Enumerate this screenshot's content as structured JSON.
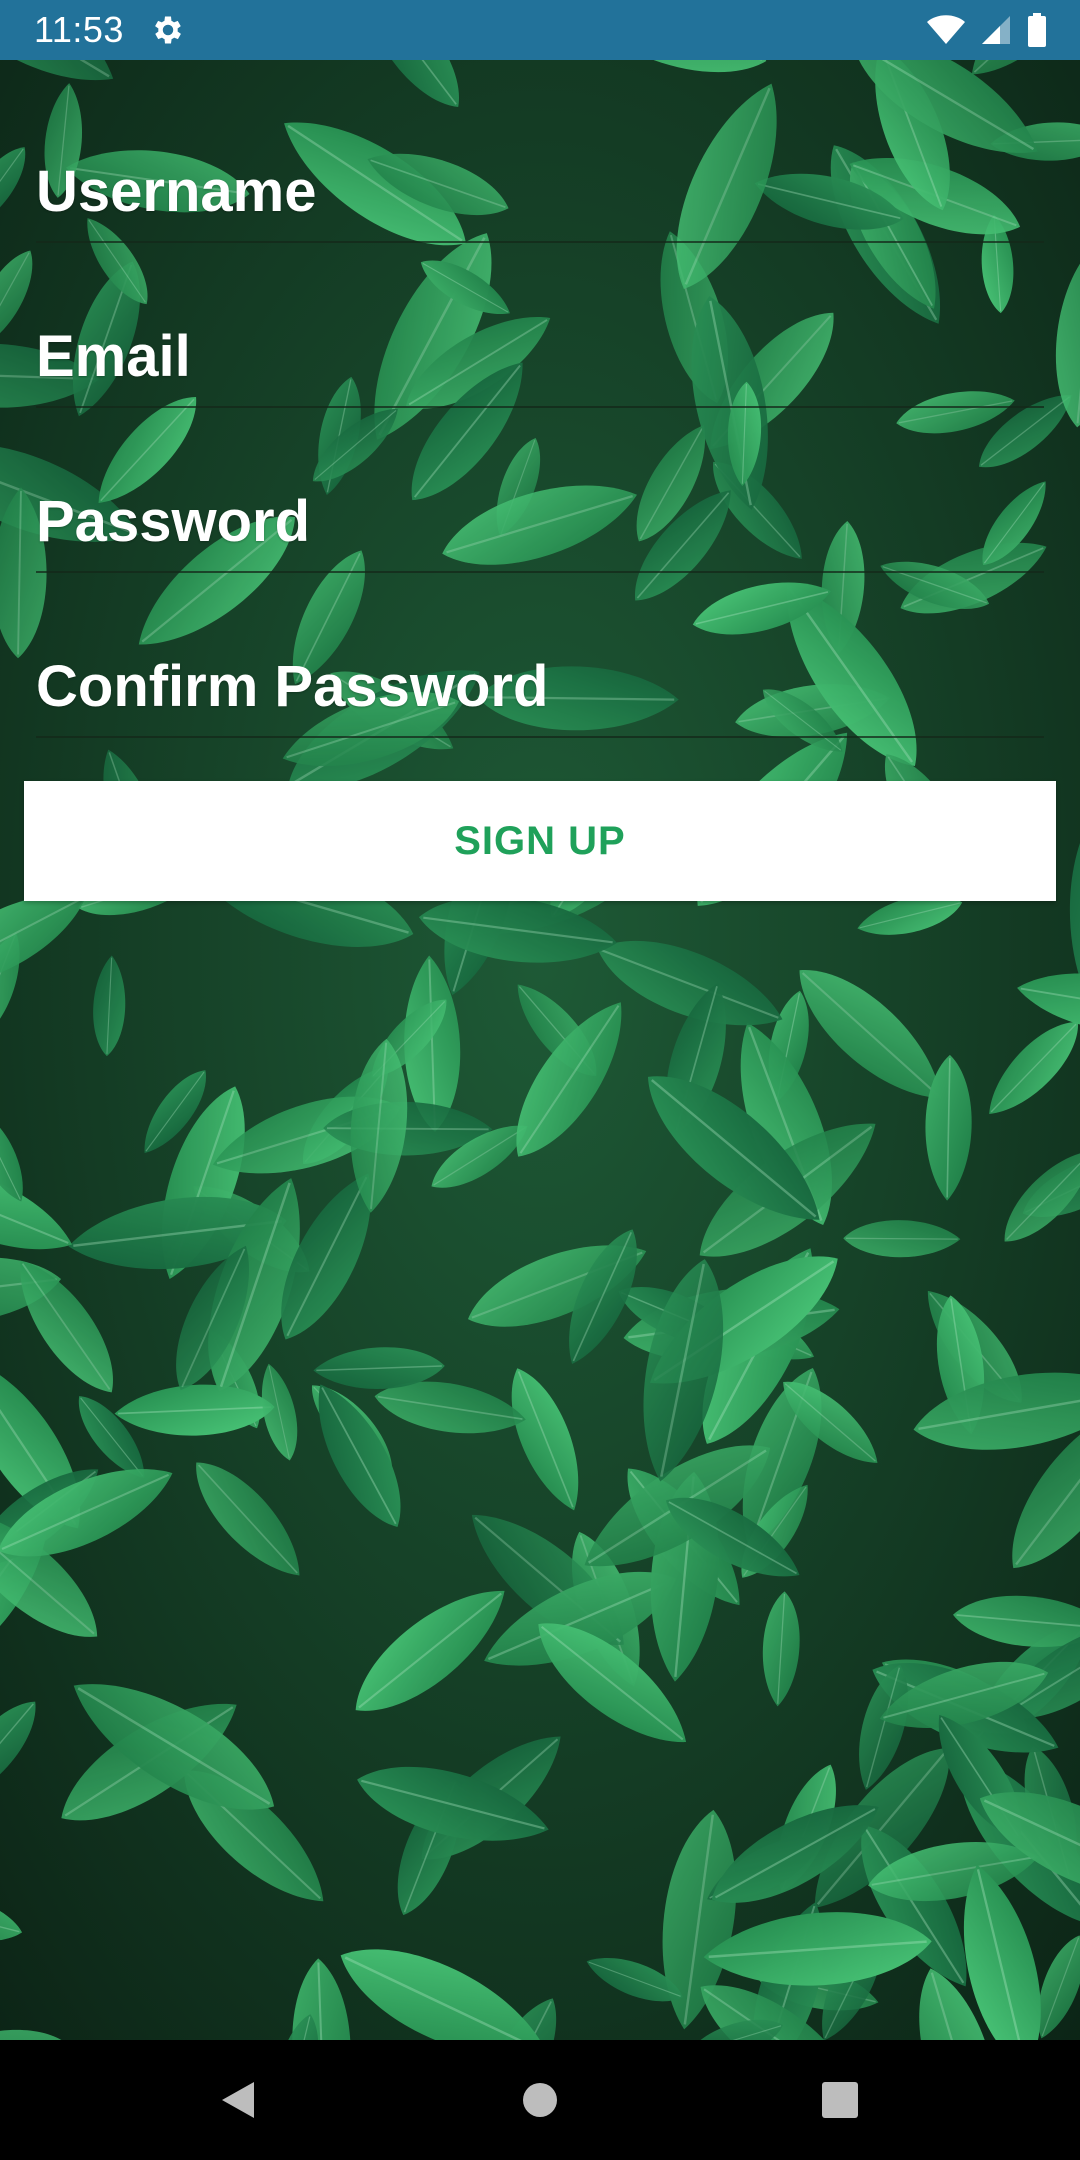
{
  "status_bar": {
    "time": "11:53",
    "icons": [
      "gear-icon",
      "wifi-icon",
      "signal-icon",
      "battery-icon"
    ],
    "background_color": "#22729a"
  },
  "form": {
    "fields": [
      {
        "label": "Username"
      },
      {
        "label": "Email"
      },
      {
        "label": "Password"
      },
      {
        "label": "Confirm Password"
      }
    ],
    "signup_label": "SIGN UP",
    "accent_color": "#1fa15a"
  },
  "nav_bar": {
    "icons": [
      "back-icon",
      "home-icon",
      "recents-icon"
    ]
  }
}
